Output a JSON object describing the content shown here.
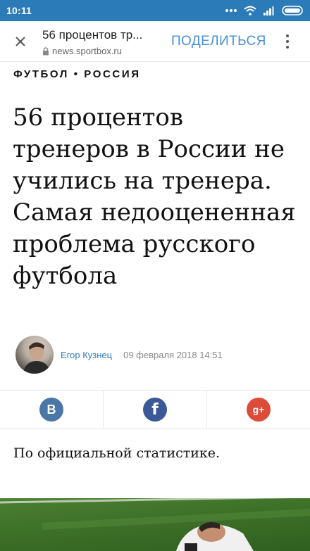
{
  "status_bar": {
    "time": "10:11"
  },
  "toolbar": {
    "title": "56 процентов тр...",
    "url": "news.sportbox.ru",
    "share_label": "ПОДЕЛИТЬСЯ"
  },
  "article": {
    "category": "ФУТБОЛ • РОССИЯ",
    "headline": "56 процентов тренеров в России не учились на тренера. Самая недооцененная проблема русского футбола",
    "author": "Егор Кузнец",
    "date": "09 февраля 2018 14:51",
    "lead": "По официальной статистике."
  },
  "share": [
    {
      "network": "vk",
      "glyph": "B",
      "color": "#4a76a8"
    },
    {
      "network": "facebook",
      "glyph": "f",
      "color": "#3b5998"
    },
    {
      "network": "google-plus",
      "glyph": "g+",
      "color": "#dd4b39"
    }
  ]
}
